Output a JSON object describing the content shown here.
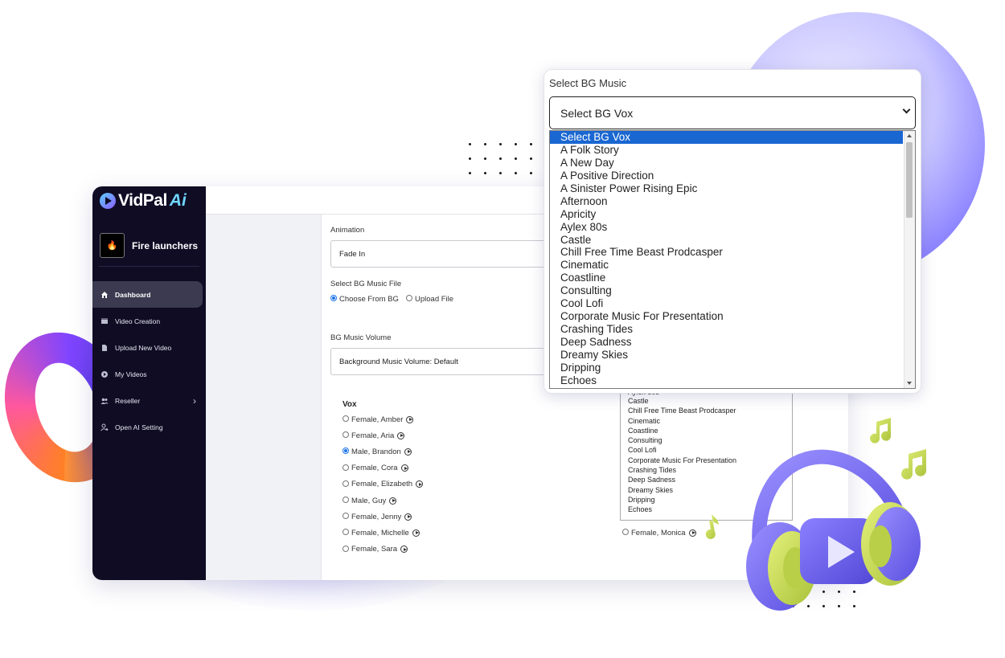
{
  "app": {
    "logo_text": "VidPal",
    "logo_suffix": "Ai",
    "brand_name": "Fire launchers",
    "brand_avatar_text": "🔥"
  },
  "sidebar": {
    "items": [
      {
        "label": "Dashboard",
        "icon": "home-icon",
        "active": true
      },
      {
        "label": "Video Creation",
        "icon": "film-icon"
      },
      {
        "label": "Upload New Video",
        "icon": "file-icon"
      },
      {
        "label": "My Videos",
        "icon": "play-circle-icon"
      },
      {
        "label": "Reseller",
        "icon": "users-icon",
        "has_submenu": true
      },
      {
        "label": "Open AI Setting",
        "icon": "user-gear-icon"
      }
    ]
  },
  "form": {
    "animation_label": "Animation",
    "animation_value": "Fade In",
    "bg_music_file_label": "Select BG Music File",
    "choose_from_bg": "Choose From BG",
    "upload_file": "Upload File",
    "bg_volume_label": "BG Music Volume",
    "bg_volume_value": "Background Music Volume: Default",
    "vox_title": "Vox",
    "vox_left": [
      "Female, Amber",
      "Female, Aria",
      "Male, Brandon",
      "Female, Cora",
      "Female, Elizabeth",
      "Male, Guy",
      "Female, Jenny",
      "Female, Michelle",
      "Female, Sara"
    ],
    "vox_selected": "Male, Brandon",
    "vox_right_visible": "Female, Monica",
    "back_list": [
      "Aylex 80s",
      "Castle",
      "Chill Free Time Beast Prodcasper",
      "Cinematic",
      "Coastline",
      "Consulting",
      "Cool Lofi",
      "Corporate Music For Presentation",
      "Crashing Tides",
      "Deep Sadness",
      "Dreamy Skies",
      "Dripping",
      "Echoes"
    ]
  },
  "popup": {
    "title": "Select BG Music",
    "selected_value": "Select BG Vox",
    "options": [
      "Select BG Vox",
      "A Folk Story",
      "A New Day",
      "A Positive Direction",
      "A Sinister Power Rising Epic",
      "Afternoon",
      "Apricity",
      "Aylex 80s",
      "Castle",
      "Chill Free Time Beast Prodcasper",
      "Cinematic",
      "Coastline",
      "Consulting",
      "Cool Lofi",
      "Corporate Music For Presentation",
      "Crashing Tides",
      "Deep Sadness",
      "Dreamy Skies",
      "Dripping",
      "Echoes"
    ],
    "highlight_color": "#1a67d2"
  },
  "colors": {
    "sidebar_bg": "#0f0c24",
    "accent": "#1a73e8",
    "headphone_purple": "#7b6ef6",
    "headphone_lime": "#c8dc5a"
  }
}
